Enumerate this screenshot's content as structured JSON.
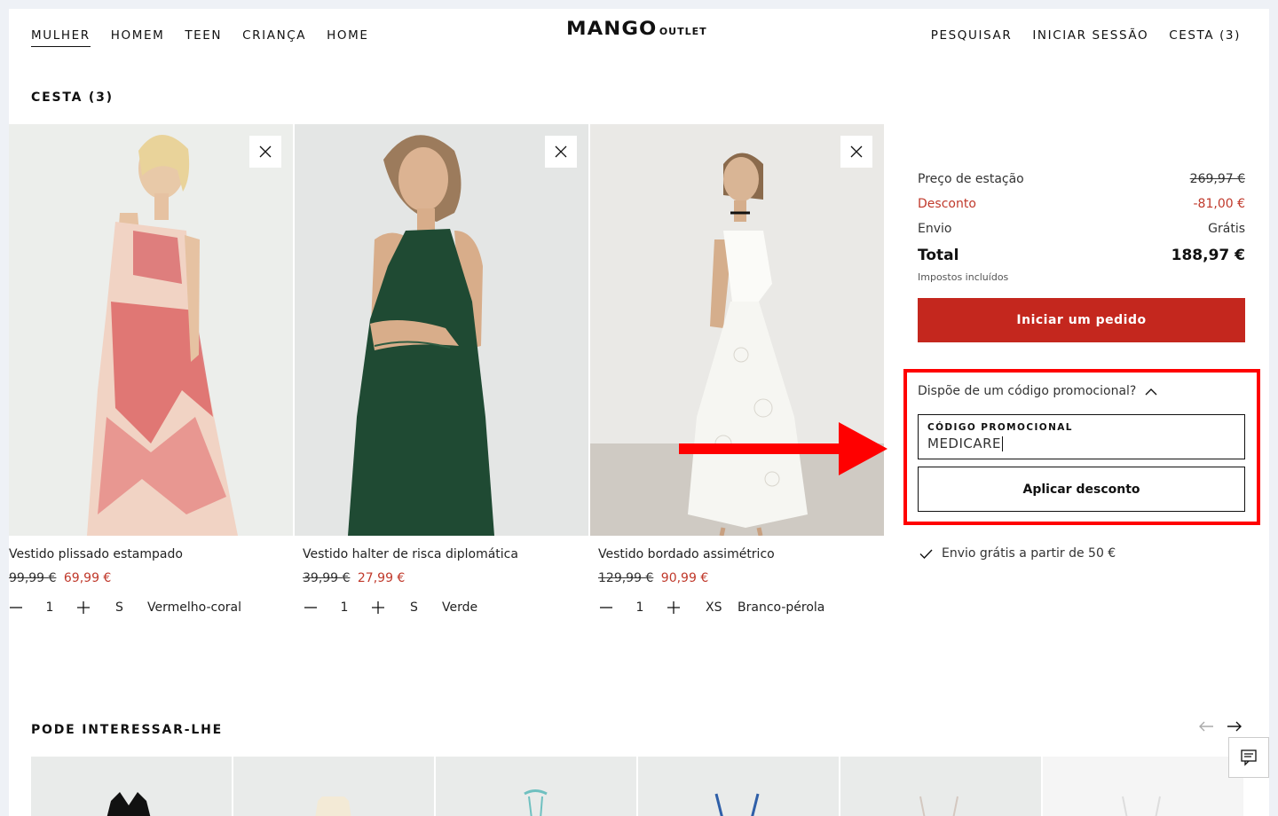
{
  "header": {
    "nav_left": [
      "MULHER",
      "HOMEM",
      "TEEN",
      "CRIANÇA",
      "HOME"
    ],
    "logo_main": "MANGO",
    "logo_sub": "OUTLET",
    "nav_right": [
      "PESQUISAR",
      "INICIAR SESSÃO",
      "CESTA (3)"
    ]
  },
  "cart": {
    "title": "CESTA (3)",
    "items": [
      {
        "name": "Vestido plissado estampado",
        "old_price": "99,99 €",
        "new_price": "69,99 €",
        "qty": "1",
        "size": "S",
        "color": "Vermelho-coral"
      },
      {
        "name": "Vestido halter de risca diplomática",
        "old_price": "39,99 €",
        "new_price": "27,99 €",
        "qty": "1",
        "size": "S",
        "color": "Verde"
      },
      {
        "name": "Vestido bordado assimétrico",
        "old_price": "129,99 €",
        "new_price": "90,99 €",
        "qty": "1",
        "size": "XS",
        "color": "Branco-pérola"
      }
    ]
  },
  "summary": {
    "season_price_label": "Preço de estação",
    "season_price_value": "269,97 €",
    "discount_label": "Desconto",
    "discount_value": "-81,00 €",
    "shipping_label": "Envio",
    "shipping_value": "Grátis",
    "total_label": "Total",
    "total_value": "188,97 €",
    "taxes_note": "Impostos incluídos",
    "checkout_label": "Iniciar um pedido"
  },
  "promo": {
    "toggle_label": "Dispõe de um código promocional?",
    "field_label": "CÓDIGO PROMOCIONAL",
    "field_value": "MEDICARE",
    "apply_label": "Aplicar desconto"
  },
  "free_shipping_note": "Envio grátis a partir de 50 €",
  "recommendations": {
    "title": "PODE INTERESSAR-LHE"
  },
  "colors": {
    "accent_red": "#c4271e",
    "discount_red": "#c0392b",
    "highlight_red": "#ff0000"
  }
}
